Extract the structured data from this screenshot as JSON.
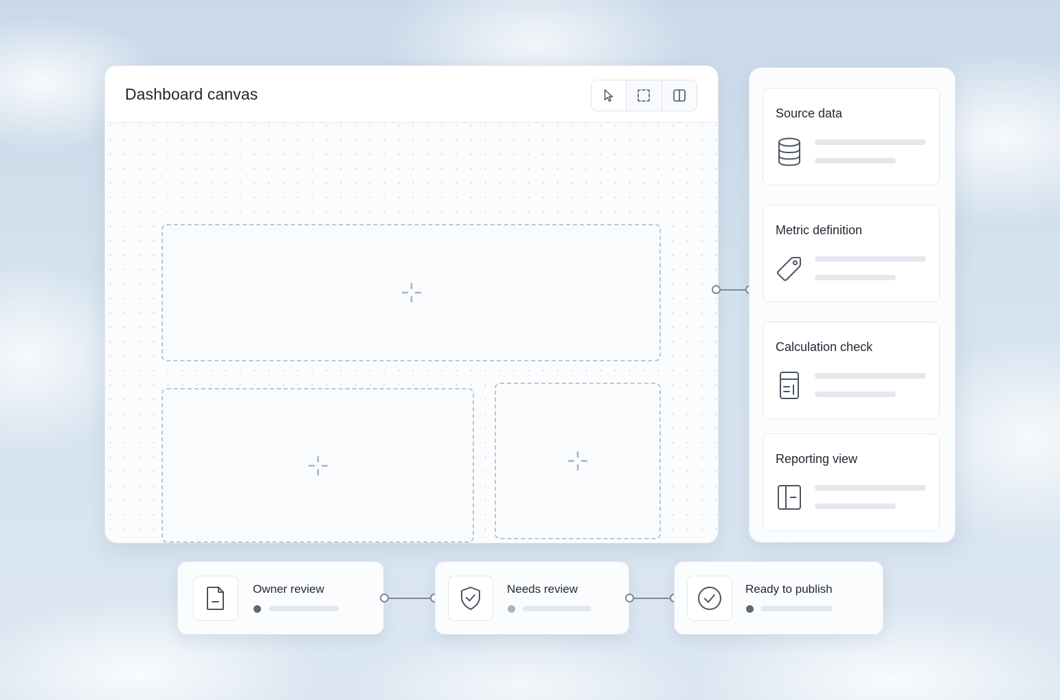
{
  "canvas": {
    "title": "Dashboard canvas",
    "tools": [
      {
        "name": "pointer-icon"
      },
      {
        "name": "marquee-select-icon"
      },
      {
        "name": "split-panel-icon"
      }
    ],
    "drop_zones": [
      {
        "name": "drop-zone-top",
        "icon": "crosshair-plus-icon"
      },
      {
        "name": "drop-zone-bottom-left",
        "icon": "crosshair-plus-icon"
      },
      {
        "name": "drop-zone-bottom-right",
        "icon": "crosshair-plus-icon"
      }
    ]
  },
  "side_panel": {
    "steps": [
      {
        "title": "Source data",
        "icon": "database-icon"
      },
      {
        "title": "Metric definition",
        "icon": "tag-icon"
      },
      {
        "title": "Calculation check",
        "icon": "calculator-icon"
      },
      {
        "title": "Reporting view",
        "icon": "layout-icon"
      }
    ]
  },
  "workflow": {
    "stages": [
      {
        "label": "Owner review",
        "icon": "document-icon",
        "dot_color": "#5f6875"
      },
      {
        "label": "Needs review",
        "icon": "shield-check-icon",
        "dot_color": "#aab4c0"
      },
      {
        "label": "Ready to publish",
        "icon": "check-circle-icon",
        "dot_color": "#5f6875"
      }
    ]
  },
  "colors": {
    "icon_stroke": "#4a5361",
    "dashed_border": "#b9c6d6",
    "connector": "#7e8896"
  }
}
